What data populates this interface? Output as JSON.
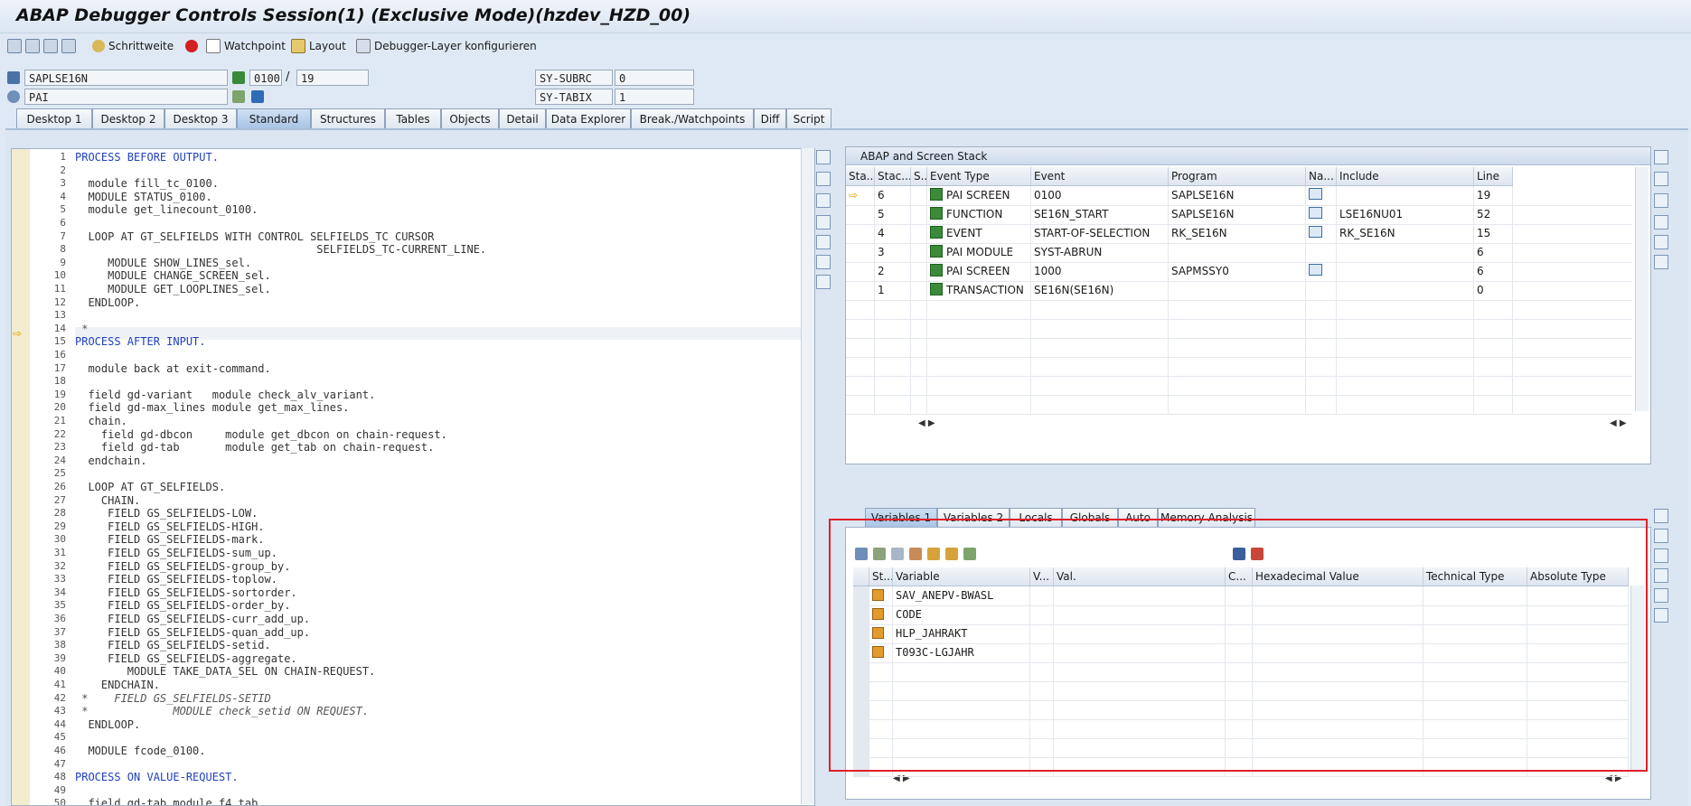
{
  "window": {
    "title": "ABAP Debugger Controls Session(1)  (Exclusive Mode)(hzdev_HZD_00)"
  },
  "toolbar": {
    "step_size": "Schrittweite",
    "watchpoint": "Watchpoint",
    "layout": "Layout",
    "debugger_layer": "Debugger-Layer  konfigurieren"
  },
  "header_fields": {
    "program": "SAPLSE16N",
    "event": "PAI",
    "screen": "0100",
    "screen_sep": "/",
    "line": "19",
    "sy_subrc_label": "SY-SUBRC",
    "sy_subrc_value": "0",
    "sy_tabix_label": "SY-TABIX",
    "sy_tabix_value": "1"
  },
  "tabs": [
    {
      "label": "Desktop 1"
    },
    {
      "label": "Desktop 2"
    },
    {
      "label": "Desktop 3"
    },
    {
      "label": "Standard",
      "active": true
    },
    {
      "label": "Structures"
    },
    {
      "label": "Tables"
    },
    {
      "label": "Objects"
    },
    {
      "label": "Detail"
    },
    {
      "label": "Data Explorer"
    },
    {
      "label": "Break./Watchpoints"
    },
    {
      "label": "Diff"
    },
    {
      "label": "Script"
    }
  ],
  "code": [
    {
      "n": "1",
      "t": "PROCESS BEFORE OUTPUT.",
      "kw": true
    },
    {
      "n": "2",
      "t": ""
    },
    {
      "n": "3",
      "t": "  module fill_tc_0100."
    },
    {
      "n": "4",
      "t": "  MODULE STATUS_0100."
    },
    {
      "n": "5",
      "t": "  module get_linecount_0100."
    },
    {
      "n": "6",
      "t": ""
    },
    {
      "n": "7",
      "t": "  LOOP AT GT_SELFIELDS WITH CONTROL SELFIELDS_TC CURSOR"
    },
    {
      "n": "8",
      "t": "                                     SELFIELDS_TC-CURRENT_LINE."
    },
    {
      "n": "9",
      "t": "     MODULE SHOW_LINES_sel."
    },
    {
      "n": "10",
      "t": "     MODULE CHANGE_SCREEN_sel."
    },
    {
      "n": "11",
      "t": "     MODULE GET_LOOPLINES_sel."
    },
    {
      "n": "12",
      "t": "  ENDLOOP."
    },
    {
      "n": "13",
      "t": ""
    },
    {
      "n": "14",
      "t": " *",
      "cmt": true
    },
    {
      "n": "15",
      "t": "PROCESS AFTER INPUT.",
      "kw": true
    },
    {
      "n": "16",
      "t": ""
    },
    {
      "n": "17",
      "t": "  module back at exit-command."
    },
    {
      "n": "18",
      "t": ""
    },
    {
      "n": "19",
      "t": "  field gd-variant   module check_alv_variant."
    },
    {
      "n": "20",
      "t": "  field gd-max_lines module get_max_lines."
    },
    {
      "n": "21",
      "t": "  chain."
    },
    {
      "n": "22",
      "t": "    field gd-dbcon     module get_dbcon on chain-request."
    },
    {
      "n": "23",
      "t": "    field gd-tab       module get_tab on chain-request."
    },
    {
      "n": "24",
      "t": "  endchain."
    },
    {
      "n": "25",
      "t": ""
    },
    {
      "n": "26",
      "t": "  LOOP AT GT_SELFIELDS."
    },
    {
      "n": "27",
      "t": "    CHAIN."
    },
    {
      "n": "28",
      "t": "     FIELD GS_SELFIELDS-LOW."
    },
    {
      "n": "29",
      "t": "     FIELD GS_SELFIELDS-HIGH."
    },
    {
      "n": "30",
      "t": "     FIELD GS_SELFIELDS-mark."
    },
    {
      "n": "31",
      "t": "     FIELD GS_SELFIELDS-sum_up."
    },
    {
      "n": "32",
      "t": "     FIELD GS_SELFIELDS-group_by."
    },
    {
      "n": "33",
      "t": "     FIELD GS_SELFIELDS-toplow."
    },
    {
      "n": "34",
      "t": "     FIELD GS_SELFIELDS-sortorder."
    },
    {
      "n": "35",
      "t": "     FIELD GS_SELFIELDS-order_by."
    },
    {
      "n": "36",
      "t": "     FIELD GS_SELFIELDS-curr_add_up."
    },
    {
      "n": "37",
      "t": "     FIELD GS_SELFIELDS-quan_add_up."
    },
    {
      "n": "38",
      "t": "     FIELD GS_SELFIELDS-setid."
    },
    {
      "n": "39",
      "t": "     FIELD GS_SELFIELDS-aggregate."
    },
    {
      "n": "40",
      "t": "        MODULE TAKE_DATA_SEL ON CHAIN-REQUEST."
    },
    {
      "n": "41",
      "t": "    ENDCHAIN."
    },
    {
      "n": "42",
      "t": " *    FIELD GS_SELFIELDS-SETID",
      "cmt": true
    },
    {
      "n": "43",
      "t": " *             MODULE check_setid ON REQUEST.",
      "cmt": true
    },
    {
      "n": "44",
      "t": "  ENDLOOP."
    },
    {
      "n": "45",
      "t": ""
    },
    {
      "n": "46",
      "t": "  MODULE fcode_0100."
    },
    {
      "n": "47",
      "t": ""
    },
    {
      "n": "48",
      "t": "PROCESS ON VALUE-REQUEST.",
      "kw": true
    },
    {
      "n": "49",
      "t": ""
    },
    {
      "n": "50",
      "t": "  field gd-tab module f4_tab."
    }
  ],
  "stack": {
    "title": "ABAP and Screen Stack",
    "columns": [
      "Sta...",
      "Stac...",
      "S...",
      "Event Type",
      "Event",
      "Program",
      "Na...",
      "Include",
      "Line"
    ],
    "rows": [
      {
        "current": true,
        "level": "6",
        "event_type": "PAI SCREEN",
        "event": "0100",
        "program": "SAPLSE16N",
        "nav": true,
        "include": "",
        "line": "19"
      },
      {
        "current": false,
        "level": "5",
        "event_type": "FUNCTION",
        "event": "SE16N_START",
        "program": "SAPLSE16N",
        "nav": true,
        "include": "LSE16NU01",
        "line": "52"
      },
      {
        "current": false,
        "level": "4",
        "event_type": "EVENT",
        "event": "START-OF-SELECTION",
        "program": "RK_SE16N",
        "nav": true,
        "include": "RK_SE16N",
        "line": "15"
      },
      {
        "current": false,
        "level": "3",
        "event_type": "PAI MODULE",
        "event": "SYST-ABRUN",
        "program": "",
        "nav": false,
        "include": "",
        "line": "6"
      },
      {
        "current": false,
        "level": "2",
        "event_type": "PAI SCREEN",
        "event": "1000",
        "program": "SAPMSSY0",
        "nav": true,
        "include": "",
        "line": "6"
      },
      {
        "current": false,
        "level": "1",
        "event_type": "TRANSACTION",
        "event": "SE16N(SE16N)",
        "program": "",
        "nav": false,
        "include": "",
        "line": "0"
      }
    ]
  },
  "variables": {
    "tabs": [
      {
        "label": "Variables 1",
        "active": true
      },
      {
        "label": "Variables 2"
      },
      {
        "label": "Locals"
      },
      {
        "label": "Globals"
      },
      {
        "label": "Auto"
      },
      {
        "label": "Memory Analysis"
      }
    ],
    "columns": [
      "St...",
      "Variable",
      "V...",
      "Val.",
      "C...",
      "Hexadecimal Value",
      "Technical Type",
      "Absolute Type"
    ],
    "rows": [
      {
        "variable": "SAV_ANEPV-BWASL"
      },
      {
        "variable": "CODE"
      },
      {
        "variable": "HLP_JAHRAKT"
      },
      {
        "variable": "T093C-LGJAHR"
      }
    ]
  },
  "colors": {
    "highlight": "#e0202a",
    "keyword": "#1f3fbf",
    "current_row_arrow": "#e8a000"
  }
}
